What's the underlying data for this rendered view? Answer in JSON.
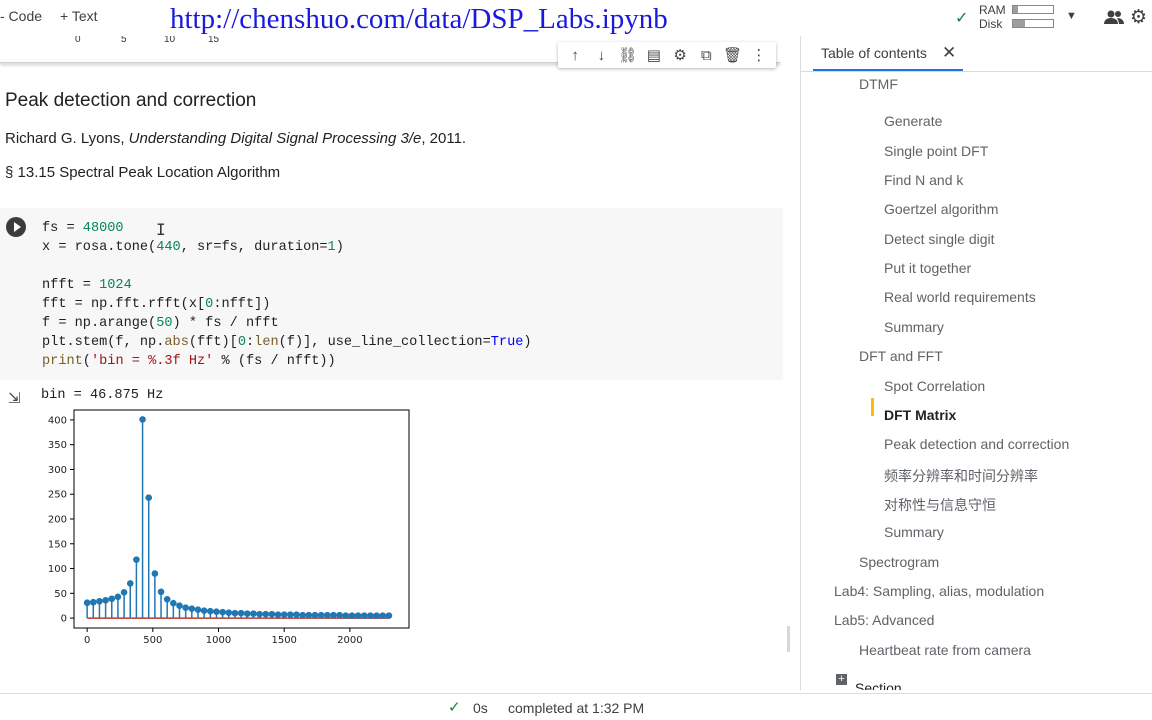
{
  "toolbar": {
    "code_label": "- Code",
    "text_label": "+ Text",
    "ram_label": "RAM",
    "disk_label": "Disk",
    "ram_fill": 0.12,
    "disk_fill": 0.3,
    "check_icon": "check-icon",
    "dropdown_icon": "chevron-down-icon",
    "share_icon": "people-icon",
    "settings_icon": "gear-icon"
  },
  "watermark": "http://chenshuo.com/data/DSP_Labs.ipynb",
  "prev_output_ticks": [
    "0",
    "5",
    "10",
    "15"
  ],
  "cell_toolbar": [
    "↑",
    "↓",
    "⛓",
    "▤",
    "⚙",
    "⧉",
    "🗑",
    "⋮"
  ],
  "markdown": {
    "heading": "Peak detection and correction",
    "citation_author": "Richard G. Lyons, ",
    "citation_title": "Understanding Digital Signal Processing 3/e",
    "citation_year": ", 2011.",
    "section": "§ 13.15 Spectral Peak Location Algorithm"
  },
  "output": {
    "text": "bin = 46.875 Hz"
  },
  "chart_data": {
    "type": "stem",
    "x_step": 46.875,
    "values": [
      31,
      32,
      34,
      36,
      39,
      43,
      52,
      70,
      118,
      401,
      243,
      90,
      53,
      38,
      30,
      25,
      21,
      19,
      17,
      15,
      14,
      13,
      12,
      11,
      10,
      10,
      9,
      9,
      8,
      8,
      8,
      7,
      7,
      7,
      7,
      6,
      6,
      6,
      6,
      6,
      6,
      6,
      5,
      5,
      5,
      5,
      5,
      5,
      5,
      5
    ],
    "xticks": [
      0,
      500,
      1000,
      1500,
      2000
    ],
    "yticks": [
      0,
      50,
      100,
      150,
      200,
      250,
      300,
      350,
      400
    ],
    "xlim": [
      -100,
      2450
    ],
    "ylim": [
      -20,
      420
    ],
    "stem_color": "#1f77b4",
    "baseline_color": "#c0392b"
  },
  "toc": {
    "header": "Table of contents",
    "items": [
      {
        "label": "DTMF",
        "indent": 1
      },
      {
        "label": "Generate",
        "indent": 2
      },
      {
        "label": "Single point DFT",
        "indent": 2
      },
      {
        "label": "Find N and k",
        "indent": 2
      },
      {
        "label": "Goertzel algorithm",
        "indent": 2
      },
      {
        "label": "Detect single digit",
        "indent": 2
      },
      {
        "label": "Put it together",
        "indent": 2
      },
      {
        "label": "Real world requirements",
        "indent": 2
      },
      {
        "label": "Summary",
        "indent": 2
      },
      {
        "label": "DFT and FFT",
        "indent": 1
      },
      {
        "label": "Spot Correlation",
        "indent": 2
      },
      {
        "label": "DFT Matrix",
        "indent": 2,
        "active": true
      },
      {
        "label": "Peak detection and correction",
        "indent": 2
      },
      {
        "label": "频率分辨率和时间分辨率",
        "indent": 2
      },
      {
        "label": "对称性与信息守恒",
        "indent": 2
      },
      {
        "label": "Summary",
        "indent": 2
      },
      {
        "label": "Spectrogram",
        "indent": 1
      },
      {
        "label": "Lab4: Sampling, alias, modulation",
        "indent": 0
      },
      {
        "label": "Lab5: Advanced",
        "indent": 0
      },
      {
        "label": "Heartbeat rate from camera",
        "indent": 1
      },
      {
        "label": "Section",
        "indent": 0
      }
    ]
  },
  "status": {
    "time": "0s",
    "message": "completed at 1:32 PM"
  }
}
